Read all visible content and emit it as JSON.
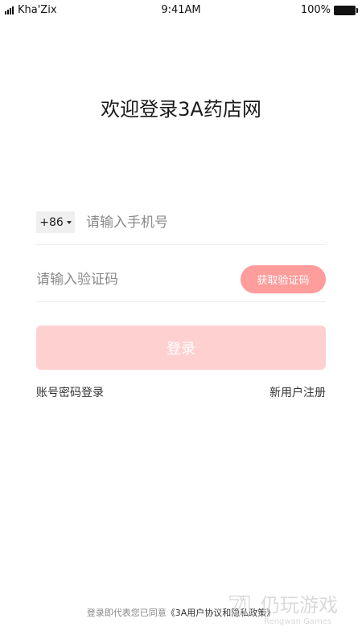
{
  "status_bar": {
    "carrier": "Kha'Zix",
    "time": "9:41AM",
    "battery": "100%"
  },
  "title": "欢迎登录3A药店网",
  "phone": {
    "country_code": "+86",
    "placeholder": "请输入手机号"
  },
  "code": {
    "placeholder": "请输入验证码",
    "get_code_label": "获取验证码"
  },
  "login_label": "登录",
  "links": {
    "password_login": "账号密码登录",
    "register": "新用户注册"
  },
  "agreement": {
    "prefix": "登录即代表您已同意",
    "document": "《3A用户协议和隐私政策》"
  },
  "colors": {
    "accent": "#ff9c9c",
    "login_disabled": "#ffd0d0"
  },
  "watermark": {
    "text": "仍玩游戏",
    "subtext": "Rengwan Games"
  }
}
